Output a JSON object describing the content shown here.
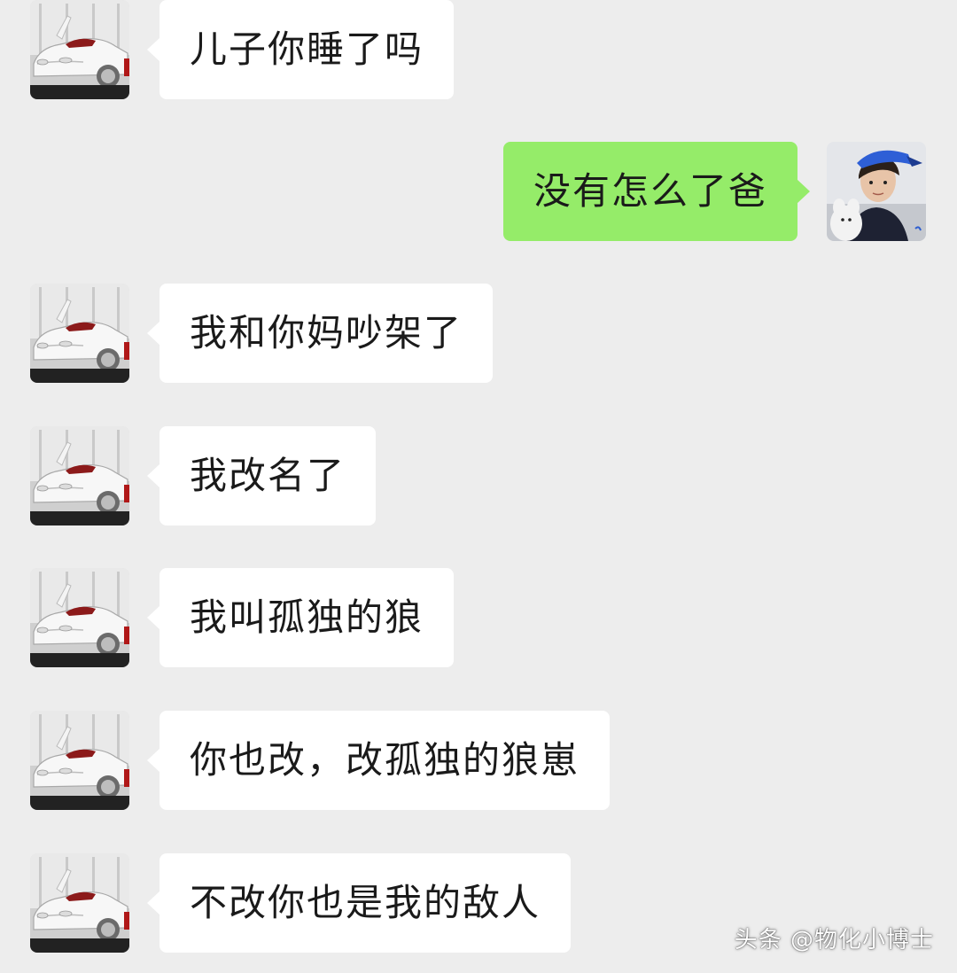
{
  "colors": {
    "background": "#ededed",
    "incoming_bubble": "#ffffff",
    "outgoing_bubble": "#95ec69",
    "text": "#1a1a1a"
  },
  "messages": [
    {
      "sender": "dad",
      "side": "left",
      "text": "儿子你睡了吗",
      "avatar": "white-car-avatar"
    },
    {
      "sender": "me",
      "side": "right",
      "text": "没有怎么了爸",
      "avatar": "boy-with-cap-avatar"
    },
    {
      "sender": "dad",
      "side": "left",
      "text": "我和你妈吵架了",
      "avatar": "white-car-avatar"
    },
    {
      "sender": "dad",
      "side": "left",
      "text": "我改名了",
      "avatar": "white-car-avatar"
    },
    {
      "sender": "dad",
      "side": "left",
      "text": "我叫孤独的狼",
      "avatar": "white-car-avatar"
    },
    {
      "sender": "dad",
      "side": "left",
      "text": "你也改，改孤独的狼崽",
      "avatar": "white-car-avatar"
    },
    {
      "sender": "dad",
      "side": "left",
      "text": "不改你也是我的敌人",
      "avatar": "white-car-avatar"
    }
  ],
  "watermark": "头条 @物化小博士"
}
